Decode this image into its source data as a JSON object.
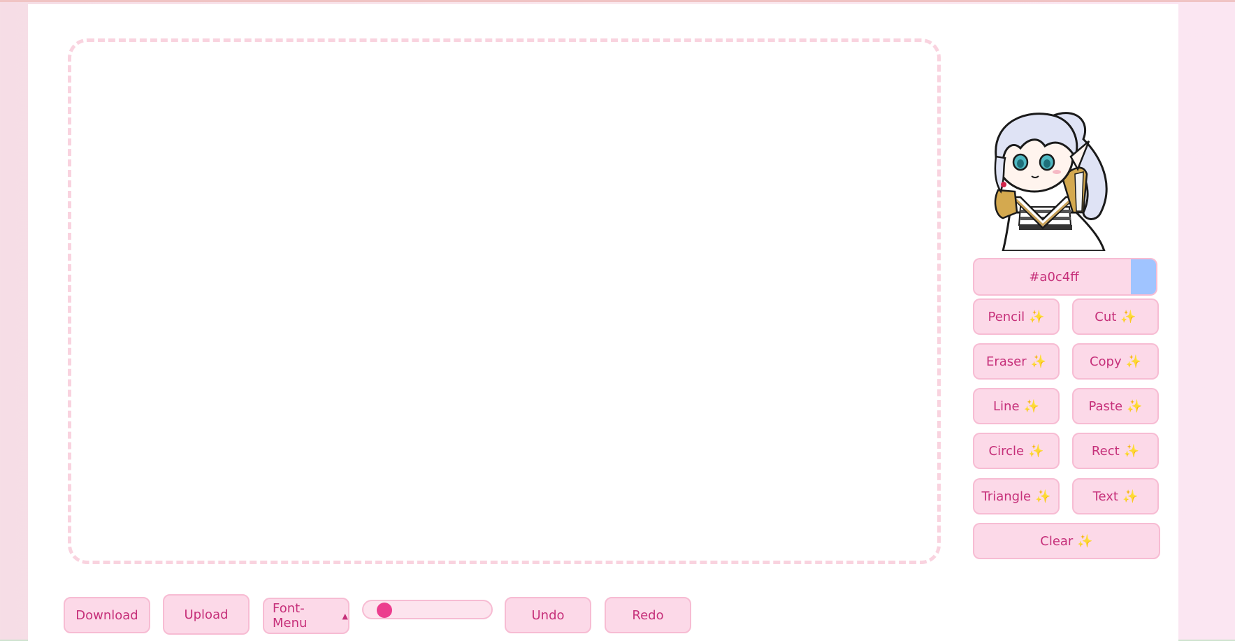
{
  "color_picker": {
    "hex_label": "#a0c4ff",
    "swatch_color": "#a0c4ff"
  },
  "tools": {
    "left": [
      {
        "label": "Pencil",
        "icon": "sparkle-icon"
      },
      {
        "label": "Eraser",
        "icon": "sparkle-icon"
      },
      {
        "label": "Line",
        "icon": "sparkle-icon"
      },
      {
        "label": "Circle",
        "icon": "sparkle-icon"
      },
      {
        "label": "Triangle",
        "icon": "sparkle-icon"
      }
    ],
    "right": [
      {
        "label": "Cut",
        "icon": "sparkle-icon"
      },
      {
        "label": "Copy",
        "icon": "sparkle-icon"
      },
      {
        "label": "Paste",
        "icon": "sparkle-icon"
      },
      {
        "label": "Rect",
        "icon": "sparkle-icon"
      },
      {
        "label": "Text",
        "icon": "sparkle-icon"
      }
    ],
    "clear": {
      "label": "Clear",
      "icon": "sparkle-icon"
    }
  },
  "bottom_bar": {
    "download": "Download",
    "upload": "Upload",
    "font_menu": "Font-Menu",
    "brush_size_fraction": 0.12,
    "undo": "Undo",
    "redo": "Redo"
  },
  "colors": {
    "accent": "#c6307a",
    "button_bg": "#fcd9e8",
    "knob": "#ec3d8e"
  }
}
